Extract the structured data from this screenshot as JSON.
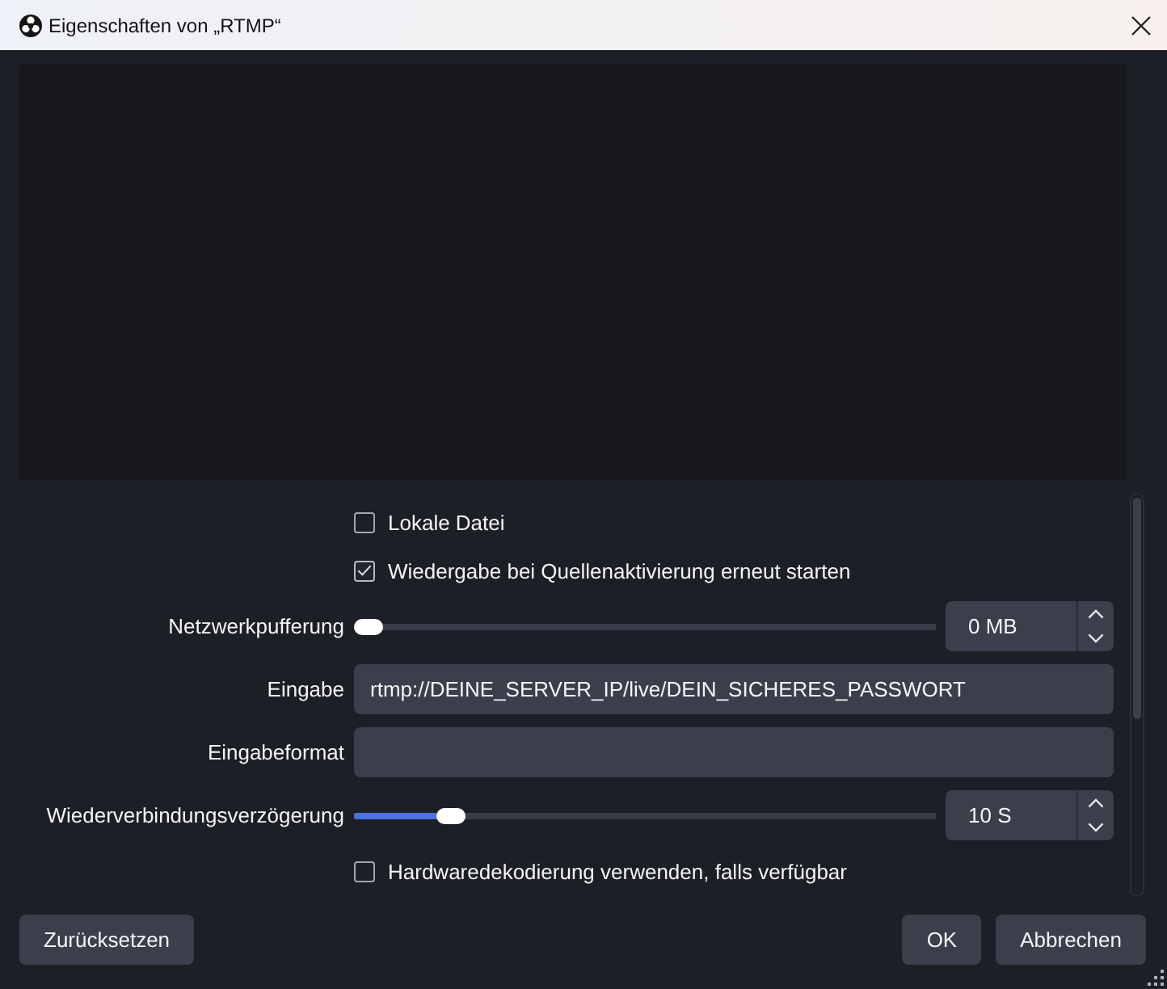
{
  "window": {
    "title": "Eigenschaften von „RTMP“"
  },
  "properties": [
    {
      "kind": "checkbox",
      "label": "Lokale Datei",
      "checked": false
    },
    {
      "kind": "checkbox",
      "label": "Wiedergabe bei Quellenaktivierung erneut starten",
      "checked": true
    },
    {
      "kind": "slider",
      "label": "Netzwerkpufferung",
      "level": 0,
      "value": "0 MB"
    },
    {
      "kind": "text",
      "label": "Eingabe",
      "value": "rtmp://DEINE_SERVER_IP/live/DEIN_SICHERES_PASSWORT"
    },
    {
      "kind": "text",
      "label": "Eingabeformat"
    },
    {
      "kind": "slider",
      "label": "Wiederverbindungsverzögerung",
      "level": 0.15,
      "value": "10 S"
    },
    {
      "kind": "checkbox",
      "label": "Hardwaredekodierung verwenden, falls verfügbar",
      "checked": false
    }
  ],
  "footer": {
    "left_buttons": [
      "Zurücksetzen"
    ],
    "right_buttons": [
      "OK",
      "Abbrechen"
    ]
  }
}
